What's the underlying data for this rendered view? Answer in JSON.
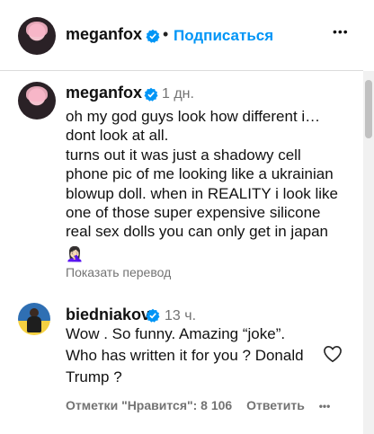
{
  "post": {
    "username": "meganfox",
    "separator": "•",
    "follow_label": "Подписаться",
    "more_label": "•••"
  },
  "caption": {
    "username": "meganfox",
    "time": "1 дн.",
    "text": "oh my god guys look how different i…\ndont look at all.\nturns out it was just a shadowy cell\nphone pic of me looking like a ukrainian\nblowup doll. when in REALITY i look like\none of those super expensive silicone\nreal sex dolls you can only get in japan",
    "emoji": "🤦🏻‍♀️",
    "translate_label": "Показать перевод"
  },
  "comment": {
    "username": "biedniakov",
    "time": "13 ч.",
    "text": "Wow . So funny. Amazing “joke”.\nWho has written it for you ? Donald\nTrump ?",
    "likes_label": "Отметки \"Нравится\": 8 106",
    "reply_label": "Ответить",
    "more_label": "•••"
  },
  "colors": {
    "accent": "#0095f6",
    "muted": "#737373",
    "verified": "#0095f6"
  },
  "icons": [
    "verified-icon",
    "heart-icon",
    "more-icon"
  ]
}
